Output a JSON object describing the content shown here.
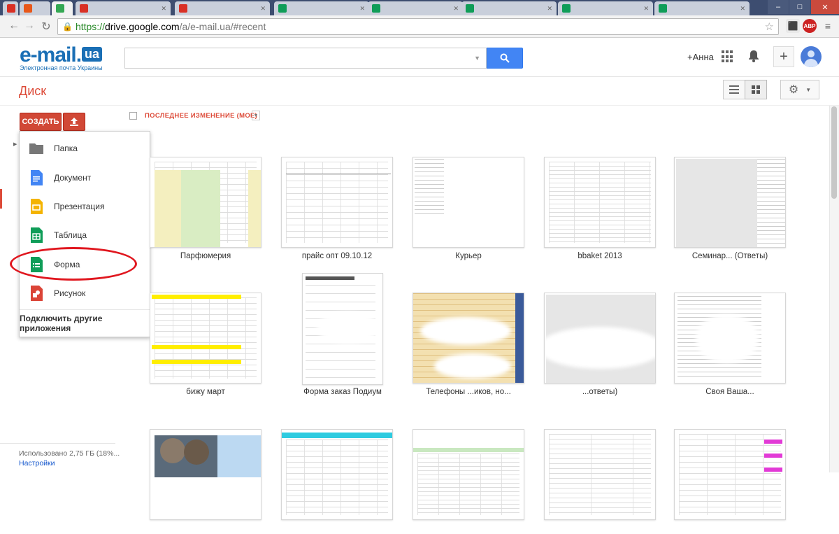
{
  "browser": {
    "tabs": [
      {
        "label": "",
        "favicon_color": "#d93025",
        "active": false
      },
      {
        "label": "",
        "favicon_color": "#e8581a",
        "active": false
      },
      {
        "label": "",
        "favicon_color": "#34a853",
        "active": true
      },
      {
        "label": "",
        "favicon_color": "#d93025",
        "active": false
      },
      {
        "label": "",
        "favicon_color": "#d93025",
        "active": false
      },
      {
        "label": "",
        "favicon_color": "#0f9d58",
        "active": false
      },
      {
        "label": "",
        "favicon_color": "#0f9d58",
        "active": false
      },
      {
        "label": "",
        "favicon_color": "#0f9d58",
        "active": false
      },
      {
        "label": "",
        "favicon_color": "#0f9d58",
        "active": false
      },
      {
        "label": "",
        "favicon_color": "#0f9d58",
        "active": false
      }
    ],
    "url": {
      "scheme": "https://",
      "host": "drive.google.com",
      "path": "/a/e-mail.ua/#recent"
    },
    "extension_badge": "ABP"
  },
  "header": {
    "logo_text": "e-mail.",
    "logo_badge": "ua",
    "logo_tagline": "Электронная почта Украины",
    "search": {
      "value": "",
      "placeholder": ""
    },
    "user_link": "+Анна"
  },
  "toolbar": {
    "title": "Диск"
  },
  "sidebar": {
    "create_label": "СОЗДАТЬ",
    "storage_text": "Использовано 2,75 ГБ (18%...",
    "settings_link": "Настройки"
  },
  "create_menu": {
    "items": [
      {
        "label": "Папка",
        "icon": "folder-icon"
      },
      {
        "label": "Документ",
        "icon": "document-icon"
      },
      {
        "label": "Презентация",
        "icon": "presentation-icon"
      },
      {
        "label": "Таблица",
        "icon": "spreadsheet-icon"
      },
      {
        "label": "Форма",
        "icon": "form-icon"
      },
      {
        "label": "Рисунок",
        "icon": "drawing-icon"
      }
    ],
    "connect_apps": "Подключить другие приложения"
  },
  "file_list": {
    "sort_label": "ПОСЛЕДНЕЕ ИЗМЕНЕНИЕ (МОЕ)",
    "files": [
      {
        "name": "Парфюмерия"
      },
      {
        "name": "прайс опт 09.10.12"
      },
      {
        "name": "Курьер"
      },
      {
        "name": "bbaket 2013"
      },
      {
        "name": "Семинар... (Ответы)"
      },
      {
        "name": "бижу март"
      },
      {
        "name": "Форма заказ Подиум"
      },
      {
        "name": "Телефоны ...иков, но..."
      },
      {
        "name": "...ответы)"
      },
      {
        "name": "Своя Ваша..."
      },
      {
        "name": ""
      },
      {
        "name": ""
      },
      {
        "name": ""
      },
      {
        "name": ""
      },
      {
        "name": ""
      }
    ]
  },
  "colors": {
    "drive_red": "#dd4b39",
    "create_button": "#d14836",
    "search_button": "#4285f4",
    "annotation_circle": "#e0171f"
  }
}
